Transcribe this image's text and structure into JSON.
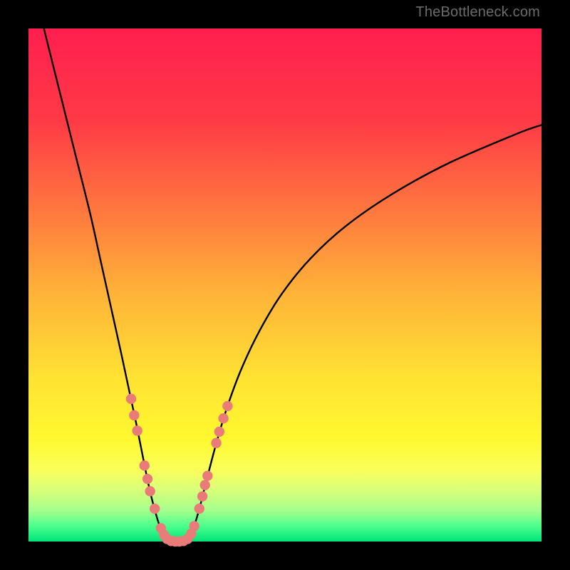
{
  "watermark": "TheBottleneck.com",
  "colors": {
    "frame": "#000000",
    "gradient_stops": [
      {
        "offset": 0.0,
        "color": "#ff1f4f"
      },
      {
        "offset": 0.18,
        "color": "#ff3a46"
      },
      {
        "offset": 0.35,
        "color": "#ff763f"
      },
      {
        "offset": 0.52,
        "color": "#ffb438"
      },
      {
        "offset": 0.68,
        "color": "#ffe233"
      },
      {
        "offset": 0.8,
        "color": "#fff82f"
      },
      {
        "offset": 0.86,
        "color": "#faff5a"
      },
      {
        "offset": 0.9,
        "color": "#d8ff7a"
      },
      {
        "offset": 0.94,
        "color": "#a4ff8c"
      },
      {
        "offset": 0.97,
        "color": "#4bff8c"
      },
      {
        "offset": 1.0,
        "color": "#00e47a"
      }
    ],
    "curve": "#000000",
    "dot_fill": "#e97b79",
    "dot_stroke": "#c75454"
  },
  "chart_data": {
    "type": "line",
    "title": "",
    "xlabel": "",
    "ylabel": "",
    "xlim": [
      0,
      100
    ],
    "ylim": [
      0,
      100
    ],
    "series": [
      {
        "name": "left-branch",
        "x": [
          3,
          6,
          9,
          12,
          14,
          16,
          18,
          19.5,
          21,
          22.2,
          23.2,
          24,
          24.8,
          25.5,
          26.2,
          27
        ],
        "y": [
          100,
          88,
          76,
          64,
          55,
          46,
          37,
          30,
          23,
          17,
          12,
          8.5,
          5.5,
          3.2,
          1.4,
          0.2
        ]
      },
      {
        "name": "valley-floor",
        "x": [
          27,
          27.8,
          28.6,
          29.4,
          30.2,
          31
        ],
        "y": [
          0.2,
          0,
          0,
          0,
          0,
          0.2
        ]
      },
      {
        "name": "right-branch",
        "x": [
          31,
          32,
          33.2,
          34.6,
          36.4,
          38.6,
          41.4,
          45,
          49.4,
          55,
          62,
          71,
          82,
          95,
          100
        ],
        "y": [
          0.2,
          2.2,
          6,
          11.5,
          18.4,
          25.8,
          33.4,
          41,
          48.3,
          55.2,
          61.6,
          67.8,
          73.8,
          79.4,
          81.2
        ]
      }
    ],
    "highlight_points": [
      {
        "x": 20.0,
        "y": 27.8
      },
      {
        "x": 20.6,
        "y": 24.6
      },
      {
        "x": 21.2,
        "y": 21.6
      },
      {
        "x": 22.6,
        "y": 14.8
      },
      {
        "x": 23.2,
        "y": 12.2
      },
      {
        "x": 23.7,
        "y": 9.8
      },
      {
        "x": 24.6,
        "y": 6.4
      },
      {
        "x": 25.8,
        "y": 2.6
      },
      {
        "x": 26.4,
        "y": 1.3
      },
      {
        "x": 27.0,
        "y": 0.5
      },
      {
        "x": 27.8,
        "y": 0.1
      },
      {
        "x": 28.6,
        "y": 0.0
      },
      {
        "x": 29.4,
        "y": 0.0
      },
      {
        "x": 30.2,
        "y": 0.1
      },
      {
        "x": 31.0,
        "y": 0.5
      },
      {
        "x": 31.7,
        "y": 1.5
      },
      {
        "x": 32.3,
        "y": 3.0
      },
      {
        "x": 33.3,
        "y": 6.4
      },
      {
        "x": 33.9,
        "y": 8.8
      },
      {
        "x": 34.4,
        "y": 11.0
      },
      {
        "x": 34.9,
        "y": 12.8
      },
      {
        "x": 36.6,
        "y": 19.2
      },
      {
        "x": 37.2,
        "y": 21.4
      },
      {
        "x": 38.0,
        "y": 24.0
      },
      {
        "x": 38.8,
        "y": 26.4
      }
    ]
  }
}
